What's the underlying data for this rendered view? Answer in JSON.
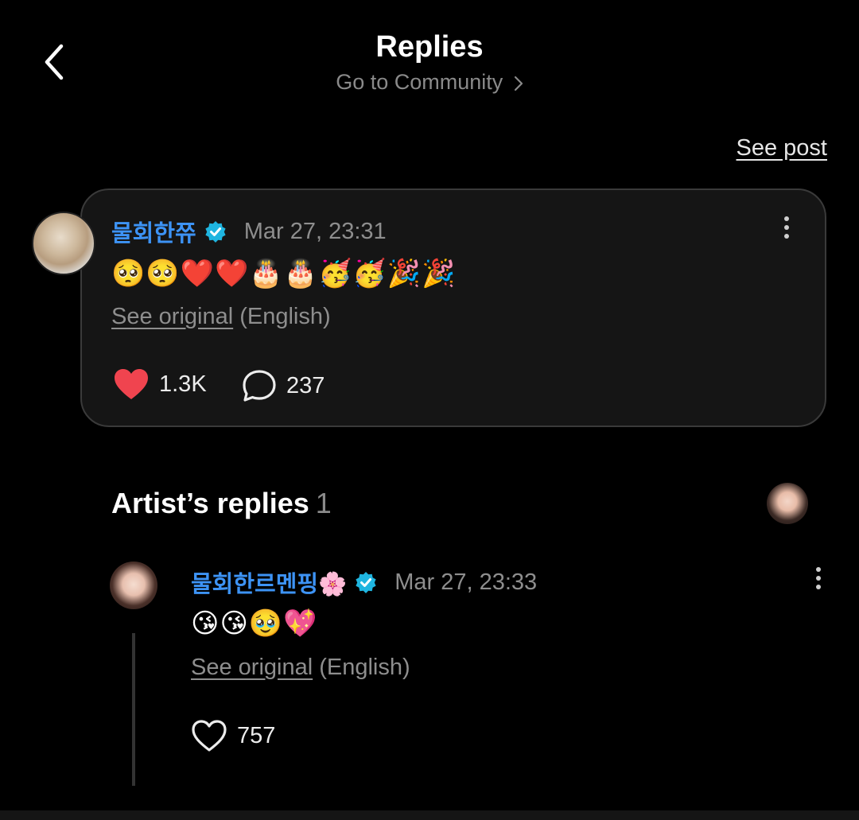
{
  "header": {
    "title": "Replies",
    "community_link": "Go to Community",
    "see_post": "See post"
  },
  "post": {
    "username": "물회한쮸",
    "timestamp": "Mar 27, 23:31",
    "text": "🥺🥺❤️❤️🎂🎂🥳🥳🎉🎉",
    "see_original": "See original",
    "language": "(English)",
    "likes": "1.3K",
    "comments": "237",
    "colors": {
      "username": "#3d93f5",
      "like": "#f0444f",
      "verified": "#1fb5e0"
    }
  },
  "artist_replies": {
    "title": "Artist’s replies",
    "count": "1"
  },
  "reply": {
    "username": "물회한르멘핑🌸",
    "timestamp": "Mar 27, 23:33",
    "text": "😘😘🥹💖",
    "see_original": "See original",
    "language": "(English)",
    "likes": "757"
  },
  "icons": {
    "back": "chevron-left-icon",
    "verified": "verified-badge-icon",
    "more": "more-vertical-icon",
    "like": "heart-icon",
    "comment": "comment-bubble-icon"
  }
}
